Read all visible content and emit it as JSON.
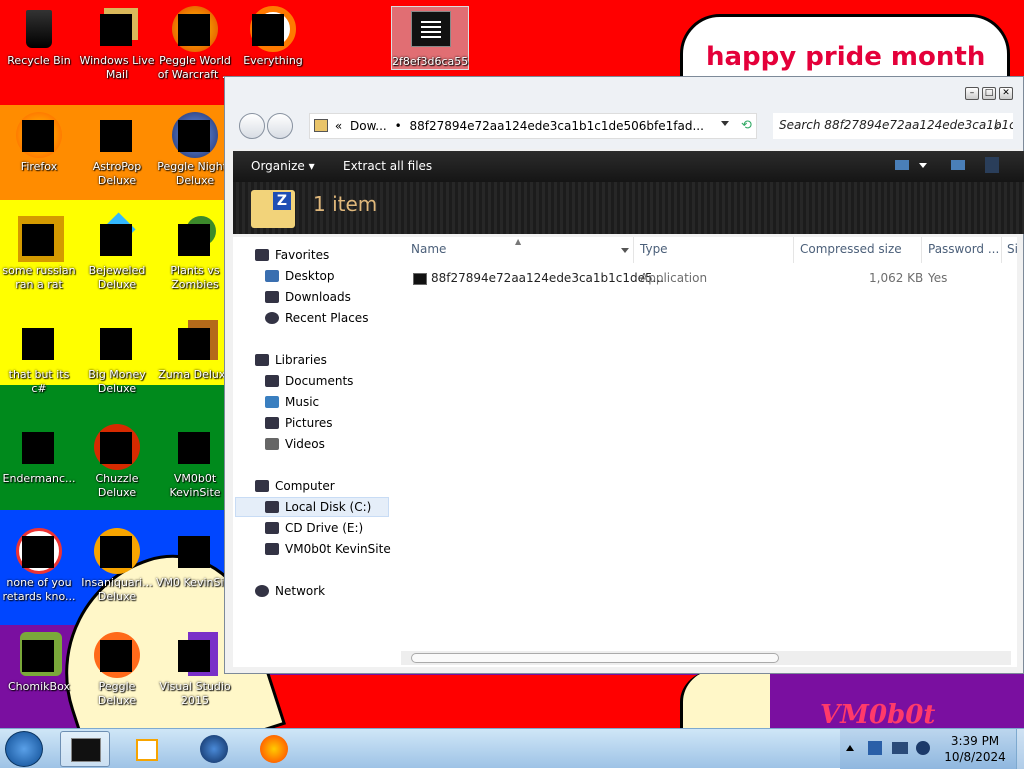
{
  "desktop": {
    "icons": [
      {
        "label": "Recycle Bin"
      },
      {
        "label": "Windows Live Mail"
      },
      {
        "label": "Peggle World of Warcraft ..."
      },
      {
        "label": "Everything"
      },
      {
        "label": "2f8ef3d6ca55"
      },
      {
        "label": "Firefox"
      },
      {
        "label": "AstroPop Deluxe"
      },
      {
        "label": "Peggle Nights Deluxe"
      },
      {
        "label": "some russian ran a rat"
      },
      {
        "label": "Bejeweled Deluxe"
      },
      {
        "label": "Plants vs Zombies"
      },
      {
        "label": "that but its c#"
      },
      {
        "label": "Big Money Deluxe"
      },
      {
        "label": "Zuma Deluxe"
      },
      {
        "label": "Endermanc..."
      },
      {
        "label": "Chuzzle Deluxe"
      },
      {
        "label": "VM0b0t KevinSite"
      },
      {
        "label": "none of you retards kno..."
      },
      {
        "label": "Insaniquari... Deluxe"
      },
      {
        "label": "VM0 KevinSi..."
      },
      {
        "label": "ChomikBox"
      },
      {
        "label": "Peggle Deluxe"
      },
      {
        "label": "Visual Studio 2015"
      }
    ],
    "wallpaper_text": "happy pride month",
    "wallpaper_bottom_text": "VM0b0t"
  },
  "explorer": {
    "address": {
      "prefix": "«",
      "crumb1": "Dow...",
      "crumb_sep": "•",
      "crumb2": "88f27894e72aa124ede3ca1b1c1de506bfe1fad..."
    },
    "search_placeholder": "Search 88f27894e72aa124ede3ca1b1c...",
    "toolbar": {
      "organize": "Organize",
      "extract": "Extract all files"
    },
    "details": {
      "count": "1 item"
    },
    "nav": {
      "favorites": "Favorites",
      "desktop": "Desktop",
      "downloads": "Downloads",
      "recent": "Recent Places",
      "libraries": "Libraries",
      "documents": "Documents",
      "music": "Music",
      "pictures": "Pictures",
      "videos": "Videos",
      "computer": "Computer",
      "local_disk": "Local Disk (C:)",
      "cd_drive": "CD Drive (E:)",
      "vm0b0t": "VM0b0t KevinSite",
      "network": "Network"
    },
    "columns": {
      "name": "Name",
      "type": "Type",
      "compressed": "Compressed size",
      "password": "Password ...",
      "size": "Si"
    },
    "file": {
      "name": "88f27894e72aa124ede3ca1b1c1de5...",
      "type": "Application",
      "compressed": "1,062 KB",
      "password": "Yes"
    }
  },
  "taskbar": {
    "time": "3:39 PM",
    "date": "10/8/2024"
  },
  "colors": {
    "infotext": "#e0b87b",
    "cloud_text": "#e4003a",
    "taskbar": "#9ec3e6"
  }
}
